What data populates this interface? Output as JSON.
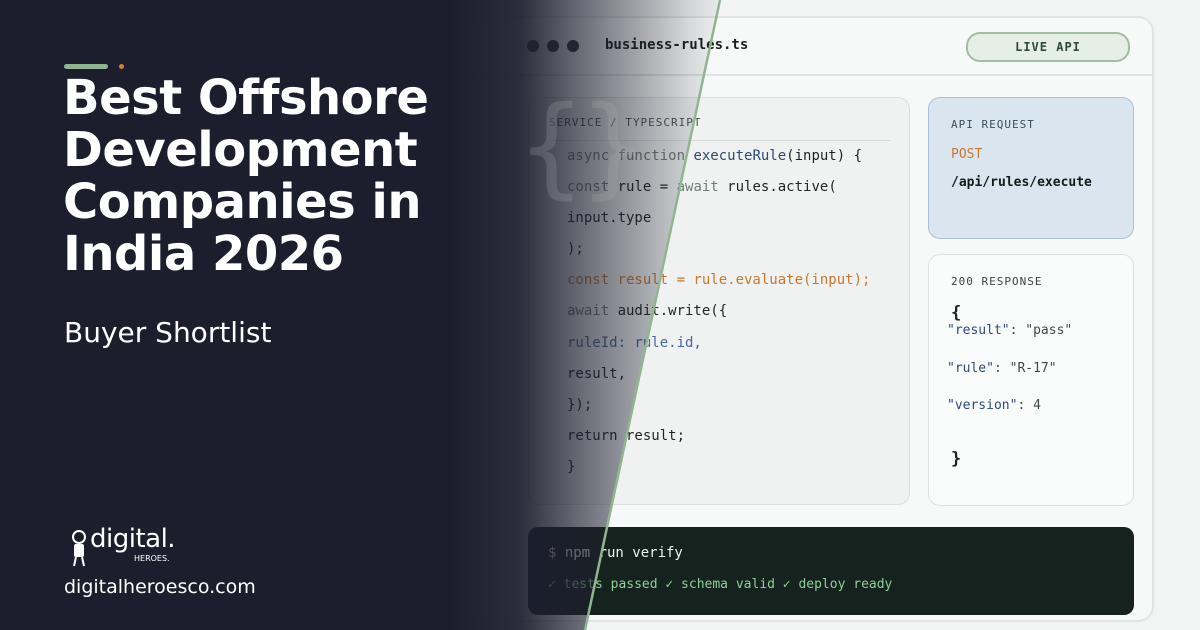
{
  "hero": {
    "headline": "Best Offshore Development Companies in India 2026",
    "subhead": "Buyer Shortlist",
    "logo_word": "digital.",
    "logo_sub": "HEROES.",
    "site_url": "digitalheroesco.com"
  },
  "window": {
    "file_name": "business-rules.ts",
    "badge": "LIVE API"
  },
  "code": {
    "header": "SERVICE / TYPESCRIPT",
    "lines": [
      "async function executeRule(input) {",
      "const rule = await rules.active(",
      "input.type",
      ");",
      "const result = rule.evaluate(input);",
      "await audit.write({",
      "ruleId: rule.id,",
      "result,",
      "});",
      "return result;",
      "}"
    ]
  },
  "api": {
    "label": "API REQUEST",
    "method": "POST",
    "path": "/api/rules/execute"
  },
  "response": {
    "label": "200 RESPONSE",
    "open": "{",
    "close": "}",
    "lines": [
      "\"result\": \"pass\"",
      "\"rule\": \"R-17\"",
      "\"version\": 4"
    ]
  },
  "terminal": {
    "command": "$ npm run verify",
    "output": "✓ tests passed ✓ schema valid ✓ deploy ready"
  },
  "colors": {
    "dark_bg": "#1c1e2e",
    "accent_green": "#8fb691",
    "accent_orange": "#d0803a",
    "terminal_bg": "#16221d"
  }
}
